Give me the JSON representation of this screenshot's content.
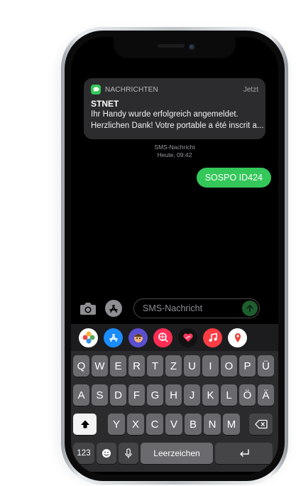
{
  "notification": {
    "app_name": "NACHRICHTEN",
    "time": "Jetzt",
    "title": "STNET",
    "body_line1": "Ihr Handy wurde erfolgreich angemeldet.",
    "body_line2": "Herzlichen Dank! Votre portable a été inscrit a..."
  },
  "conversation": {
    "meta_label": "SMS-Nachricht",
    "meta_time": "Heute, 09:42",
    "messages": [
      {
        "text": "SOSPO ID424",
        "direction": "outgoing",
        "color": "#34c759"
      }
    ]
  },
  "input": {
    "placeholder": "SMS-Nachricht",
    "value": ""
  },
  "app_strip": [
    {
      "icon": "photos-icon"
    },
    {
      "icon": "app-store-icon"
    },
    {
      "icon": "memoji-icon"
    },
    {
      "icon": "web-search-icon"
    },
    {
      "icon": "digital-touch-icon"
    },
    {
      "icon": "music-icon"
    },
    {
      "icon": "maps-icon"
    }
  ],
  "keyboard": {
    "row1": [
      "Q",
      "W",
      "E",
      "R",
      "T",
      "Z",
      "U",
      "I",
      "O",
      "P",
      "Ü"
    ],
    "row2": [
      "A",
      "S",
      "D",
      "F",
      "G",
      "H",
      "J",
      "K",
      "L",
      "Ö",
      "Ä"
    ],
    "row3": [
      "Y",
      "X",
      "C",
      "V",
      "B",
      "N",
      "M"
    ],
    "numbers_label": "123",
    "space_label": "Leerzeichen"
  },
  "colors": {
    "imessage_green": "#34c759",
    "notification_bg": "#2c2c2e",
    "keyboard_bg": "#2b2b2d"
  }
}
